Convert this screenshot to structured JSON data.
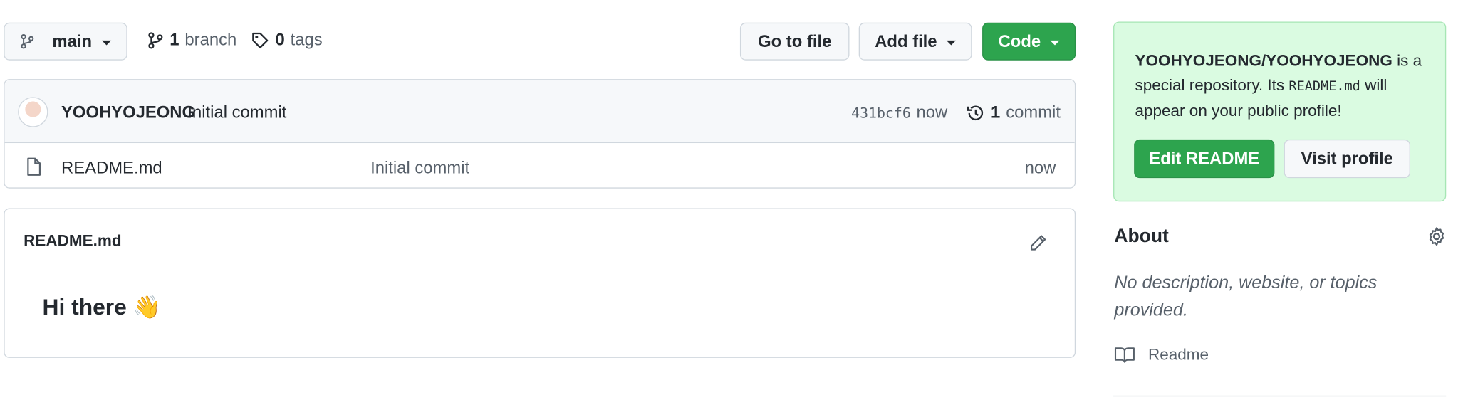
{
  "toolbar": {
    "branch_label": "main",
    "branches_count": "1",
    "branches_label": "branch",
    "tags_count": "0",
    "tags_label": "tags",
    "go_to_file": "Go to file",
    "add_file": "Add file",
    "code": "Code"
  },
  "commit": {
    "author": "YOOHYOJEONG",
    "message": "Initial commit",
    "sha": "431bcf6",
    "time": "now",
    "count": "1",
    "count_label": "commit"
  },
  "files": [
    {
      "name": "README.md",
      "message": "Initial commit",
      "time": "now"
    }
  ],
  "readme": {
    "title": "README.md",
    "heading": "Hi there 👋"
  },
  "sidebar": {
    "promo": {
      "repo": "YOOHYOJEONG/YOOHYOJEONG",
      "text_1": "is a special repository. Its",
      "file": "README.md",
      "text_2": "will appear on your public profile!",
      "edit_button": "Edit README",
      "visit_button": "Visit profile"
    },
    "about": {
      "title": "About",
      "description": "No description, website, or topics provided.",
      "readme_link": "Readme"
    }
  },
  "colors": {
    "primary_green": "#2da44e",
    "promo_bg": "#dafbe1",
    "border": "#d0d7de"
  }
}
